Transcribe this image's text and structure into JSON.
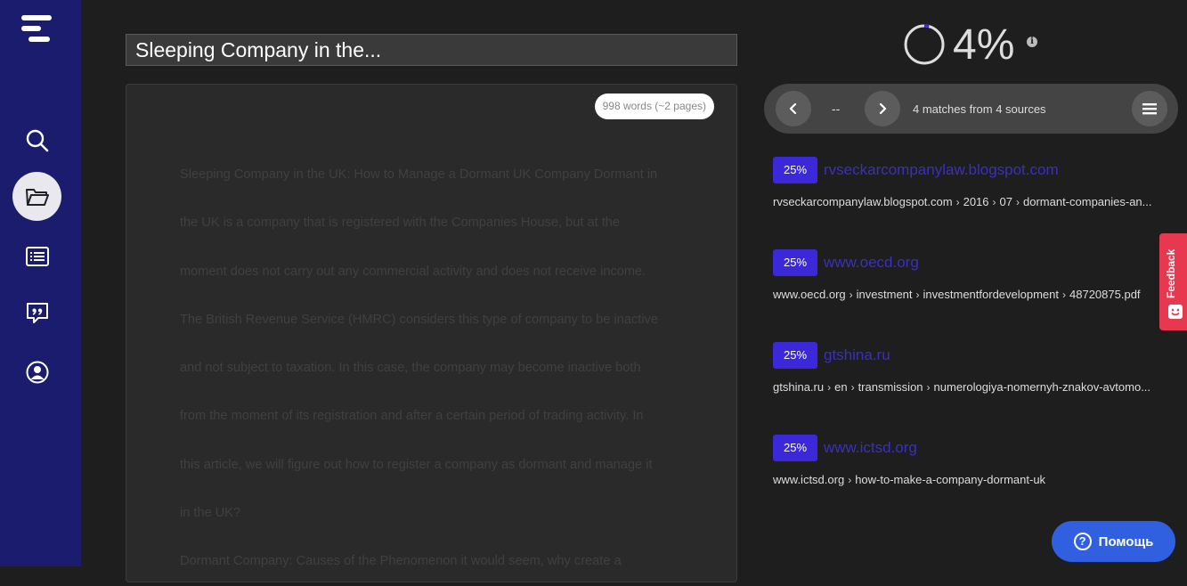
{
  "nav": {
    "items": [
      {
        "icon": "search-icon"
      },
      {
        "icon": "folder-icon",
        "active": true
      },
      {
        "icon": "list-icon"
      },
      {
        "icon": "quote-bubble-icon"
      },
      {
        "icon": "user-icon"
      }
    ]
  },
  "document": {
    "title": "Sleeping Company in the...",
    "word_count": "998 words (~2 pages)",
    "lines": [
      "Sleeping Company in the UK: How to Manage a Dormant UK Company Dormant in",
      "the UK is a company that is registered with the Companies House, but at the",
      "moment does not carry out any commercial activity and does not receive income.",
      "The British Revenue Service (HMRC) considers this type of company to be inactive",
      "and not subject to taxation. In this case, the company may become inactive both",
      "from the moment of its registration and after a certain period of trading activity. In",
      "this article, we will figure out how to register a company as dormant and manage it",
      "in the UK?",
      "Dormant Company: Causes of the Phenomenon it would seem, why create a"
    ]
  },
  "score": {
    "value": "4%",
    "progress": 0.04,
    "info": "i"
  },
  "matches": {
    "current": "--",
    "summary": "4 matches from 4 sources"
  },
  "sources": [
    {
      "percent": "25%",
      "domain": "rvseckarcompanylaw.blogspot.com",
      "path": [
        "rvseckarcompanylaw.blogspot.com",
        "2016",
        "07",
        "dormant-companies-an..."
      ]
    },
    {
      "percent": "25%",
      "domain": "www.oecd.org",
      "path": [
        "www.oecd.org",
        "investment",
        "investmentfordevelopment",
        "48720875.pdf"
      ]
    },
    {
      "percent": "25%",
      "domain": "gtshina.ru",
      "path": [
        "gtshina.ru",
        "en",
        "transmission",
        "numerologiya-nomernyh-znakov-avtomo..."
      ]
    },
    {
      "percent": "25%",
      "domain": "www.ictsd.org",
      "path": [
        "www.ictsd.org",
        "how-to-make-a-company-dormant-uk"
      ]
    }
  ],
  "feedback": {
    "label": "Feedback"
  },
  "help": {
    "label": "Помощь",
    "icon": "?"
  },
  "colors": {
    "sidebar": "#1c1c6e",
    "accent": "#3b28d8",
    "feedback": "#e8384f",
    "help": "#3060e0"
  }
}
